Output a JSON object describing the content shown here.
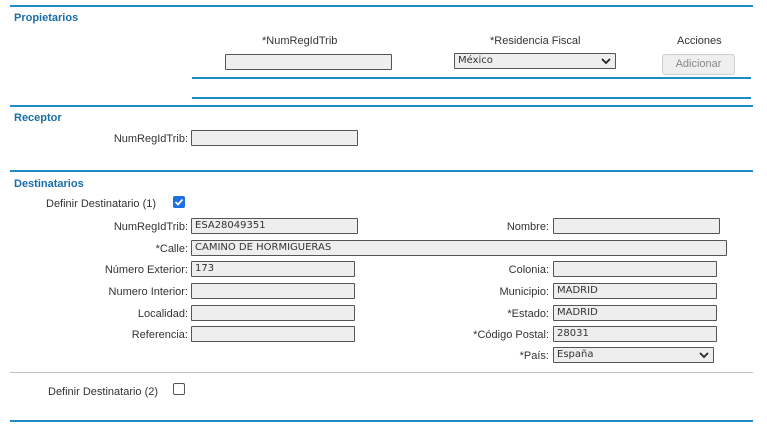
{
  "propietarios": {
    "title": "Propietarios",
    "col_numreg": "*NumRegIdTrib",
    "col_residencia": "*Residencia Fiscal",
    "col_acciones": "Acciones",
    "numreg_value": "",
    "residencia_value": "México",
    "adicionar_label": "Adicionar"
  },
  "receptor": {
    "title": "Receptor",
    "numreg_label": "NumRegIdTrib:",
    "numreg_value": ""
  },
  "destinatarios": {
    "title": "Destinatarios",
    "definir1_label": "Definir Destinatario (1)",
    "definir1_checked": true,
    "definir2_label": "Definir Destinatario (2)",
    "definir2_checked": false,
    "fields": {
      "numreg": {
        "label": "NumRegIdTrib:",
        "value": "ESA28049351"
      },
      "nombre": {
        "label": "Nombre:",
        "value": ""
      },
      "calle": {
        "label": "*Calle:",
        "value": "CAMINO DE HORMIGUERAS"
      },
      "numero_exterior": {
        "label": "Número Exterior:",
        "value": "173"
      },
      "colonia": {
        "label": "Colonia:",
        "value": ""
      },
      "numero_interior": {
        "label": "Numero Interior:",
        "value": ""
      },
      "municipio": {
        "label": "Municipio:",
        "value": "MADRID"
      },
      "localidad": {
        "label": "Localidad:",
        "value": ""
      },
      "estado": {
        "label": "*Estado:",
        "value": "MADRID"
      },
      "referencia": {
        "label": "Referencia:",
        "value": ""
      },
      "codigo_postal": {
        "label": "*Código  Postal:",
        "value": "28031"
      },
      "pais": {
        "label": "*País:",
        "value": "España"
      }
    }
  },
  "colors": {
    "accent_rule": "#1e8bc3",
    "section_title": "#1a6ea8",
    "checkbox_checked": "#1e6fe0",
    "input_bg": "#eeeeee"
  }
}
